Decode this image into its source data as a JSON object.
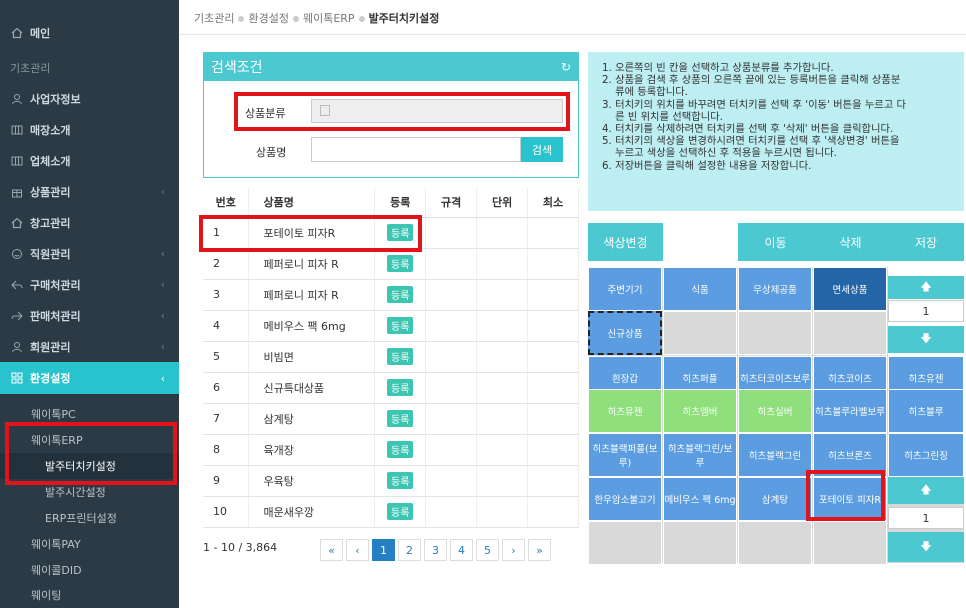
{
  "sidebar": {
    "main": "메인",
    "basic": "기초관리",
    "items": [
      "사업자정보",
      "매장소개",
      "업체소개",
      "상품관리",
      "창고관리",
      "직원관리",
      "구매처관리",
      "판매처관리",
      "회원관리",
      "환경설정"
    ],
    "subs": [
      "웨이톡PC",
      "웨이톡ERP",
      "발주터치키설정",
      "발주시간설정",
      "ERP프린터설정",
      "웨이톡PAY",
      "웨이콜DID",
      "웨이팅"
    ]
  },
  "breadcrumb": {
    "b1": "기초관리",
    "b2": "환경설정",
    "b3": "웨이톡ERP",
    "b4": "발주터치키설정"
  },
  "search": {
    "title": "검색조건",
    "category_label": "상품분류",
    "name_label": "상품명",
    "button": "검색"
  },
  "table": {
    "headers": [
      "번호",
      "상품명",
      "등록",
      "규격",
      "단위",
      "최소"
    ],
    "reg_label": "등록",
    "rows": [
      {
        "no": "1",
        "name": "포테이토 피자R"
      },
      {
        "no": "2",
        "name": "페퍼로니 피자 R"
      },
      {
        "no": "3",
        "name": "페퍼로니 피자 R"
      },
      {
        "no": "4",
        "name": "메비우스 팩 6mg"
      },
      {
        "no": "5",
        "name": "비빔면"
      },
      {
        "no": "6",
        "name": "신규특대상품"
      },
      {
        "no": "7",
        "name": "삼계탕"
      },
      {
        "no": "8",
        "name": "육개장"
      },
      {
        "no": "9",
        "name": "우육탕"
      },
      {
        "no": "10",
        "name": "매운새우깡"
      }
    ]
  },
  "pager": {
    "range": "1 - 10 / 3,864",
    "first": "«",
    "prev": "‹",
    "pages": [
      "1",
      "2",
      "3",
      "4",
      "5"
    ],
    "next": "›",
    "last": "»"
  },
  "help": [
    "1. 오른쪽의 빈 칸을 선택하고 상품분류를 추가합니다.",
    "2. 상품을 검색 후 상품의 오른쪽 끝에 있는 등록버튼을 클릭해 상품분",
    "    류에 등록합니다.",
    "3. 터치키의 위치를 바꾸려면 터치키를 선택 후 '이동' 버튼을 누르고 다",
    "    른 빈 위치를 선택합니다.",
    "4. 터치키를 삭제하려면 터치키를 선택 후 '삭제' 버튼을 클릭합니다.",
    "5. 터치키의 색상을 변경하시려면 터치키를 선택 후 '색상변경' 버튼을",
    "    누르고 색상을 선택하신 후 적용을 누르시면 됩니다.",
    "6. 저장버튼을 클릭해 설정한 내용을 저장합니다."
  ],
  "actions": {
    "color": "색상변경",
    "move": "이동",
    "delete": "삭제",
    "save": "저장"
  },
  "categories": [
    "주변기기",
    "식품",
    "무상제공품",
    "면세상품",
    "신규상품"
  ],
  "keys": {
    "r1": [
      "흰장갑",
      "히츠퍼플",
      "히츠터코이즈보루",
      "히츠코이즈",
      "히츠유젠"
    ],
    "r2": [
      "히츠유젠",
      "히츠앰버",
      "히츠실버",
      "히츠블루라벨보루",
      "히츠블루"
    ],
    "r3": [
      "히츠블랙퍼플(보루)",
      "히츠블랙그린/보루",
      "히츠블랙그린",
      "히츠브론즈",
      "히츠그린징"
    ],
    "r4": [
      "한우암소불고기",
      "메비우스 팩 6mg",
      "삼계탕",
      "포테이토 피자R"
    ]
  },
  "pagenum": {
    "top": "1",
    "bottom": "1"
  }
}
